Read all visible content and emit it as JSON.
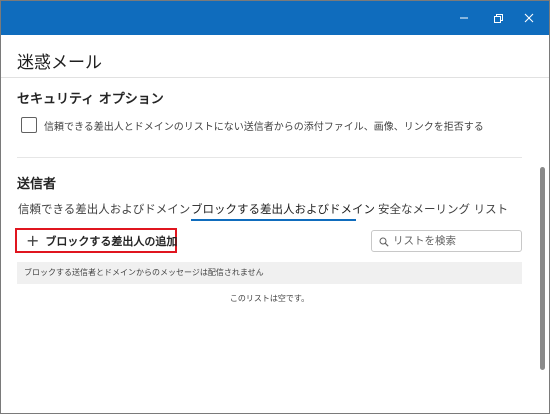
{
  "window": {
    "minimize_icon": "minimize-icon",
    "restore_icon": "restore-icon",
    "close_icon": "close-icon",
    "titlebar_color": "#0f6cbd"
  },
  "dialog": {
    "title": "迷惑メール"
  },
  "security": {
    "heading": "セキュリティ オプション",
    "checkbox_label": "信頼できる差出人とドメインのリストにない送信者からの添付ファイル、画像、リンクを拒否する",
    "checked": false
  },
  "senders": {
    "heading": "送信者",
    "tabs": [
      {
        "label": "信頼できる差出人およびドメイン",
        "selected": false
      },
      {
        "label": "ブロックする差出人およびドメイン",
        "selected": true
      },
      {
        "label": "安全なメーリング リスト",
        "selected": false
      }
    ],
    "add_button": {
      "icon": "plus-icon",
      "label": "ブロックする差出人の追加",
      "highlight_color": "#e0151f"
    },
    "search": {
      "icon": "search-icon",
      "placeholder": "リストを検索"
    },
    "info_text": "ブロックする送信者とドメインからのメッセージは配信されません",
    "empty_text": "このリストは空です。"
  }
}
